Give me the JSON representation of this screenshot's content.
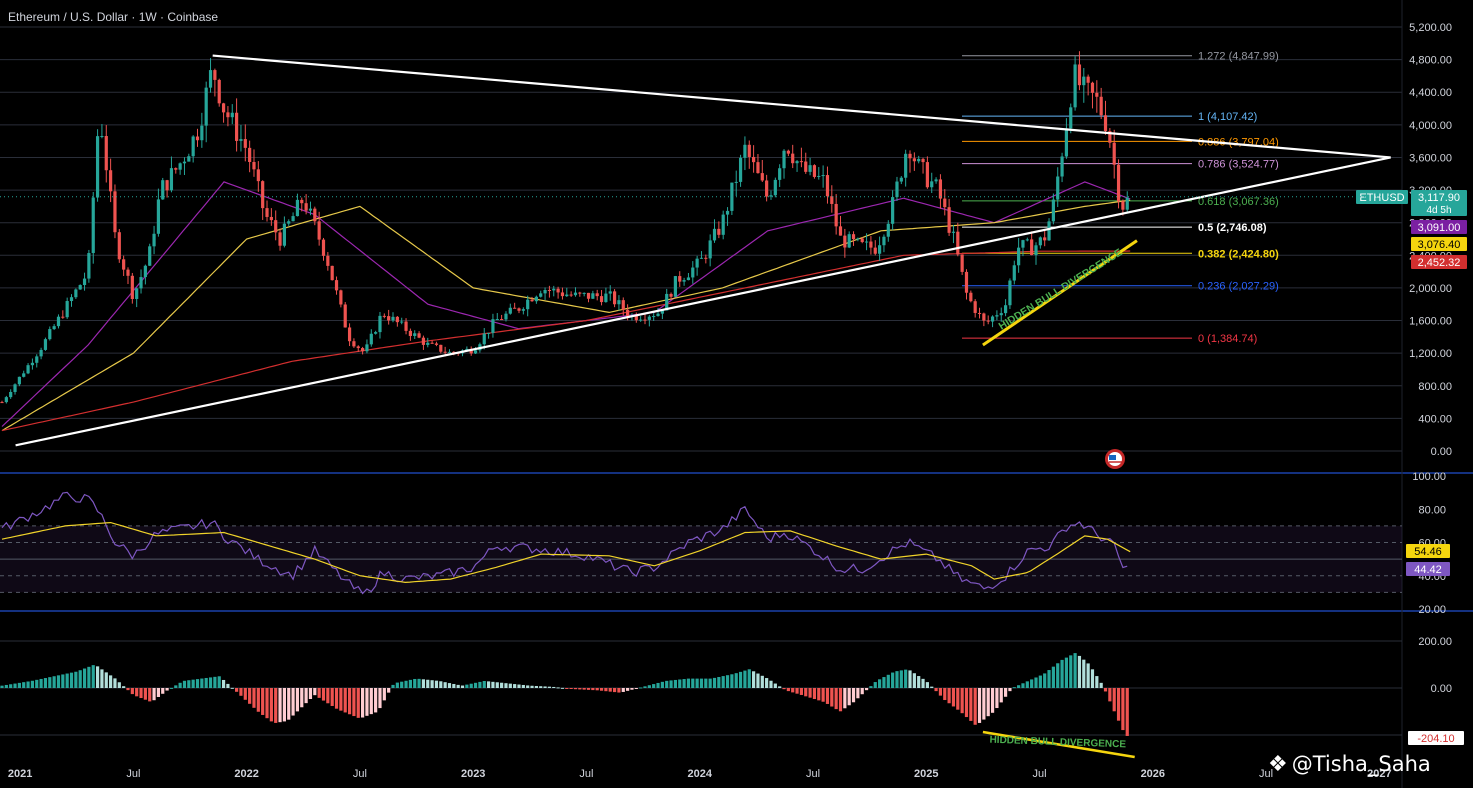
{
  "header": {
    "title": "Ethereum / U.S. Dollar · 1W · Coinbase"
  },
  "watermark": {
    "text": "@Tisha_Saha",
    "icon": "binance-logo-icon"
  },
  "colors": {
    "bg": "#000000",
    "grid": "#2a2e39",
    "up": "#26a69a",
    "down": "#ef5350",
    "rsi": "#7e57c2",
    "rsi_ma": "#f0d32a",
    "ema_fast": "#9c27b0",
    "ema_mid": "#e6c84a",
    "ema_slow": "#d32f2f",
    "trend": "#ffffff",
    "support": "#f5d50e",
    "text": "#d1d4dc"
  },
  "chart_data": [
    {
      "type": "candlestick",
      "title": "Ethereum / U.S. Dollar · 1W · Coinbase",
      "ylim": [
        0,
        5200
      ],
      "x_ticks": [
        "2021",
        "Jul",
        "2022",
        "Jul",
        "2023",
        "Jul",
        "2024",
        "Jul",
        "2025",
        "Jul",
        "2026",
        "Jul",
        "2027"
      ],
      "y_ticks": [
        "5,200.00",
        "4,800.00",
        "4,400.00",
        "4,000.00",
        "3,600.00",
        "3,200.00",
        "2,800.00",
        "2,400.00",
        "2,000.00",
        "1,600.00",
        "1,200.00",
        "800.00",
        "400.00",
        "0.00"
      ],
      "price_path": [
        [
          2020.92,
          600
        ],
        [
          2021.1,
          1300
        ],
        [
          2021.2,
          1750
        ],
        [
          2021.3,
          2200
        ],
        [
          2021.35,
          4200
        ],
        [
          2021.42,
          2600
        ],
        [
          2021.5,
          1900
        ],
        [
          2021.57,
          2400
        ],
        [
          2021.62,
          3200
        ],
        [
          2021.7,
          3500
        ],
        [
          2021.78,
          3900
        ],
        [
          2021.85,
          4700
        ],
        [
          2021.9,
          4200
        ],
        [
          2022.0,
          3700
        ],
        [
          2022.08,
          2900
        ],
        [
          2022.15,
          2600
        ],
        [
          2022.25,
          3100
        ],
        [
          2022.35,
          2400
        ],
        [
          2022.45,
          1400
        ],
        [
          2022.52,
          1200
        ],
        [
          2022.6,
          1700
        ],
        [
          2022.7,
          1500
        ],
        [
          2022.8,
          1300
        ],
        [
          2022.9,
          1200
        ],
        [
          2023.0,
          1250
        ],
        [
          2023.1,
          1600
        ],
        [
          2023.2,
          1750
        ],
        [
          2023.3,
          2000
        ],
        [
          2023.45,
          1900
        ],
        [
          2023.6,
          1900
        ],
        [
          2023.7,
          1650
        ],
        [
          2023.82,
          1700
        ],
        [
          2023.9,
          2100
        ],
        [
          2024.0,
          2300
        ],
        [
          2024.1,
          2800
        ],
        [
          2024.2,
          3700
        ],
        [
          2024.3,
          3100
        ],
        [
          2024.38,
          3800
        ],
        [
          2024.45,
          3450
        ],
        [
          2024.55,
          3300
        ],
        [
          2024.62,
          2600
        ],
        [
          2024.72,
          2500
        ],
        [
          2024.78,
          2500
        ],
        [
          2024.85,
          3000
        ],
        [
          2024.92,
          3800
        ],
        [
          2024.96,
          3500
        ],
        [
          2025.05,
          3200
        ],
        [
          2025.12,
          2600
        ],
        [
          2025.18,
          1900
        ],
        [
          2025.26,
          1550
        ],
        [
          2025.35,
          1800
        ],
        [
          2025.4,
          2500
        ],
        [
          2025.47,
          2500
        ],
        [
          2025.52,
          2600
        ],
        [
          2025.56,
          3000
        ],
        [
          2025.6,
          3700
        ],
        [
          2025.65,
          4600
        ],
        [
          2025.7,
          4400
        ],
        [
          2025.75,
          4300
        ],
        [
          2025.8,
          4000
        ],
        [
          2025.86,
          3000
        ],
        [
          2025.9,
          3100
        ]
      ],
      "series": [
        {
          "name": "EMA fast",
          "points": [
            [
              2020.92,
              300
            ],
            [
              2021.3,
              1300
            ],
            [
              2021.9,
              3300
            ],
            [
              2022.3,
              2900
            ],
            [
              2022.8,
              1800
            ],
            [
              2023.2,
              1500
            ],
            [
              2023.8,
              1700
            ],
            [
              2024.3,
              2700
            ],
            [
              2024.9,
              3100
            ],
            [
              2025.3,
              2800
            ],
            [
              2025.7,
              3300
            ],
            [
              2025.9,
              3091
            ]
          ]
        },
        {
          "name": "EMA mid",
          "points": [
            [
              2020.92,
              250
            ],
            [
              2021.5,
              1200
            ],
            [
              2022.0,
              2600
            ],
            [
              2022.5,
              3000
            ],
            [
              2023.0,
              2000
            ],
            [
              2023.6,
              1700
            ],
            [
              2024.1,
              2000
            ],
            [
              2024.8,
              2700
            ],
            [
              2025.3,
              2800
            ],
            [
              2025.7,
              3000
            ],
            [
              2025.9,
              3076.4
            ]
          ]
        },
        {
          "name": "EMA slow",
          "points": [
            [
              2020.92,
              250
            ],
            [
              2021.5,
              600
            ],
            [
              2022.2,
              1100
            ],
            [
              2022.8,
              1350
            ],
            [
              2023.5,
              1600
            ],
            [
              2024.2,
              2000
            ],
            [
              2024.9,
              2400
            ],
            [
              2025.5,
              2450
            ],
            [
              2025.9,
              2452.32
            ]
          ]
        }
      ],
      "trendlines": [
        {
          "name": "upper",
          "points": [
            [
              2021.85,
              4850
            ],
            [
              2027.05,
              3600
            ]
          ]
        },
        {
          "name": "lower",
          "points": [
            [
              2020.98,
              70
            ],
            [
              2027.05,
              3600
            ]
          ]
        },
        {
          "name": "hidden-bull-support",
          "points": [
            [
              2025.25,
              1300
            ],
            [
              2025.93,
              2580
            ]
          ]
        }
      ],
      "annotation": "HIDDEN BULL DIVERGENCE",
      "fib_levels": [
        {
          "label": "1.272 (4,847.99)",
          "value": 4847.99,
          "color": "#9598a1"
        },
        {
          "label": "1 (4,107.42)",
          "value": 4107.42,
          "color": "#64b5f6"
        },
        {
          "label": "0.886 (3,797.04)",
          "value": 3797.04,
          "color": "#ff9800"
        },
        {
          "label": "0.786 (3,524.77)",
          "value": 3524.77,
          "color": "#ce93d8"
        },
        {
          "label": "0.618 (3,067.36)",
          "value": 3067.36,
          "color": "#4caf50"
        },
        {
          "label": "0.5 (2,746.08)",
          "value": 2746.08,
          "color": "#ffffff"
        },
        {
          "label": "0.382 (2,424.80)",
          "value": 2424.8,
          "color": "#f5d50e"
        },
        {
          "label": "0.236 (2,027.29)",
          "value": 2027.29,
          "color": "#2962ff"
        },
        {
          "label": "0 (1,384.74)",
          "value": 1384.74,
          "color": "#f23645"
        }
      ],
      "price_tags": [
        {
          "text": "ETHUSD",
          "value": 3117.9,
          "bg": "#26a69a"
        },
        {
          "text": "3,117.90",
          "sub": "4d 5h",
          "value": 3117.9,
          "bg": "#26a69a"
        },
        {
          "text": "3,091.00",
          "value": 3091.0,
          "bg": "#7b1fa2"
        },
        {
          "text": "3,076.40",
          "value": 3076.4,
          "bg": "#f5d50e"
        },
        {
          "text": "2,452.32",
          "value": 2452.32,
          "bg": "#d32f2f"
        }
      ]
    },
    {
      "type": "line",
      "ylim": [
        20,
        100
      ],
      "y_ticks": [
        "100.00",
        "80.00",
        "60.00",
        "40.00",
        "20.00"
      ],
      "bands": [
        70,
        60,
        50,
        40,
        30
      ],
      "series": [
        {
          "name": "RSI",
          "points": [
            [
              2020.92,
              68
            ],
            [
              2021.1,
              80
            ],
            [
              2021.2,
              88
            ],
            [
              2021.3,
              86
            ],
            [
              2021.35,
              78
            ],
            [
              2021.42,
              60
            ],
            [
              2021.5,
              52
            ],
            [
              2021.6,
              65
            ],
            [
              2021.7,
              68
            ],
            [
              2021.85,
              72
            ],
            [
              2021.9,
              64
            ],
            [
              2022.05,
              50
            ],
            [
              2022.2,
              40
            ],
            [
              2022.3,
              55
            ],
            [
              2022.45,
              35
            ],
            [
              2022.52,
              28
            ],
            [
              2022.6,
              42
            ],
            [
              2022.7,
              38
            ],
            [
              2022.85,
              40
            ],
            [
              2023.0,
              45
            ],
            [
              2023.1,
              58
            ],
            [
              2023.3,
              56
            ],
            [
              2023.5,
              52
            ],
            [
              2023.7,
              42
            ],
            [
              2023.8,
              45
            ],
            [
              2023.95,
              60
            ],
            [
              2024.1,
              68
            ],
            [
              2024.2,
              80
            ],
            [
              2024.3,
              62
            ],
            [
              2024.38,
              66
            ],
            [
              2024.5,
              56
            ],
            [
              2024.62,
              44
            ],
            [
              2024.72,
              44
            ],
            [
              2024.85,
              55
            ],
            [
              2024.92,
              60
            ],
            [
              2025.05,
              50
            ],
            [
              2025.15,
              38
            ],
            [
              2025.26,
              32
            ],
            [
              2025.35,
              40
            ],
            [
              2025.45,
              55
            ],
            [
              2025.55,
              58
            ],
            [
              2025.62,
              70
            ],
            [
              2025.68,
              72
            ],
            [
              2025.75,
              65
            ],
            [
              2025.82,
              60
            ],
            [
              2025.87,
              44.42
            ],
            [
              2025.9,
              44.42
            ]
          ]
        },
        {
          "name": "RSI MA",
          "points": [
            [
              2020.92,
              62
            ],
            [
              2021.2,
              70
            ],
            [
              2021.4,
              72
            ],
            [
              2021.6,
              64
            ],
            [
              2021.9,
              66
            ],
            [
              2022.1,
              58
            ],
            [
              2022.3,
              50
            ],
            [
              2022.5,
              40
            ],
            [
              2022.7,
              36
            ],
            [
              2022.9,
              38
            ],
            [
              2023.1,
              45
            ],
            [
              2023.3,
              53
            ],
            [
              2023.6,
              52
            ],
            [
              2023.8,
              46
            ],
            [
              2024.0,
              55
            ],
            [
              2024.2,
              66
            ],
            [
              2024.4,
              67
            ],
            [
              2024.6,
              58
            ],
            [
              2024.8,
              50
            ],
            [
              2025.0,
              53
            ],
            [
              2025.2,
              46
            ],
            [
              2025.3,
              38
            ],
            [
              2025.45,
              42
            ],
            [
              2025.6,
              55
            ],
            [
              2025.7,
              64
            ],
            [
              2025.8,
              62
            ],
            [
              2025.9,
              54.46
            ]
          ]
        }
      ],
      "labels": [
        {
          "text": "54.46",
          "value": 54.46,
          "bg": "#f5d50e"
        },
        {
          "text": "44.42",
          "value": 44.42,
          "bg": "#7e57c2"
        }
      ]
    },
    {
      "type": "bar",
      "ylim": [
        -250,
        250
      ],
      "y_ticks": [
        "200.00",
        "0.00"
      ],
      "annotation": "HIDDEN BULL DIVERGENCE",
      "points": [
        [
          2020.92,
          10
        ],
        [
          2021.05,
          30
        ],
        [
          2021.15,
          50
        ],
        [
          2021.25,
          70
        ],
        [
          2021.33,
          100
        ],
        [
          2021.42,
          40
        ],
        [
          2021.5,
          -30
        ],
        [
          2021.58,
          -60
        ],
        [
          2021.65,
          -10
        ],
        [
          2021.72,
          30
        ],
        [
          2021.8,
          40
        ],
        [
          2021.88,
          50
        ],
        [
          2021.96,
          -20
        ],
        [
          2022.05,
          -100
        ],
        [
          2022.12,
          -150
        ],
        [
          2022.18,
          -140
        ],
        [
          2022.3,
          -30
        ],
        [
          2022.4,
          -90
        ],
        [
          2022.5,
          -130
        ],
        [
          2022.58,
          -100
        ],
        [
          2022.65,
          20
        ],
        [
          2022.75,
          40
        ],
        [
          2022.85,
          30
        ],
        [
          2022.95,
          10
        ],
        [
          2023.05,
          30
        ],
        [
          2023.15,
          20
        ],
        [
          2023.25,
          10
        ],
        [
          2023.35,
          5
        ],
        [
          2023.45,
          -5
        ],
        [
          2023.55,
          -10
        ],
        [
          2023.65,
          -20
        ],
        [
          2023.75,
          5
        ],
        [
          2023.85,
          30
        ],
        [
          2023.95,
          40
        ],
        [
          2024.05,
          40
        ],
        [
          2024.15,
          60
        ],
        [
          2024.22,
          80
        ],
        [
          2024.3,
          40
        ],
        [
          2024.38,
          -10
        ],
        [
          2024.45,
          -30
        ],
        [
          2024.55,
          -60
        ],
        [
          2024.62,
          -100
        ],
        [
          2024.68,
          -60
        ],
        [
          2024.78,
          30
        ],
        [
          2024.86,
          70
        ],
        [
          2024.92,
          80
        ],
        [
          2025.0,
          30
        ],
        [
          2025.08,
          -50
        ],
        [
          2025.15,
          -100
        ],
        [
          2025.22,
          -160
        ],
        [
          2025.3,
          -100
        ],
        [
          2025.38,
          0
        ],
        [
          2025.45,
          30
        ],
        [
          2025.52,
          60
        ],
        [
          2025.6,
          120
        ],
        [
          2025.66,
          150
        ],
        [
          2025.72,
          100
        ],
        [
          2025.78,
          10
        ],
        [
          2025.83,
          -100
        ],
        [
          2025.88,
          -204.1
        ],
        [
          2025.9,
          -204.1
        ]
      ],
      "labels": [
        {
          "text": "-204.10",
          "value": -204.1,
          "bg": "#ffffff"
        }
      ]
    }
  ]
}
